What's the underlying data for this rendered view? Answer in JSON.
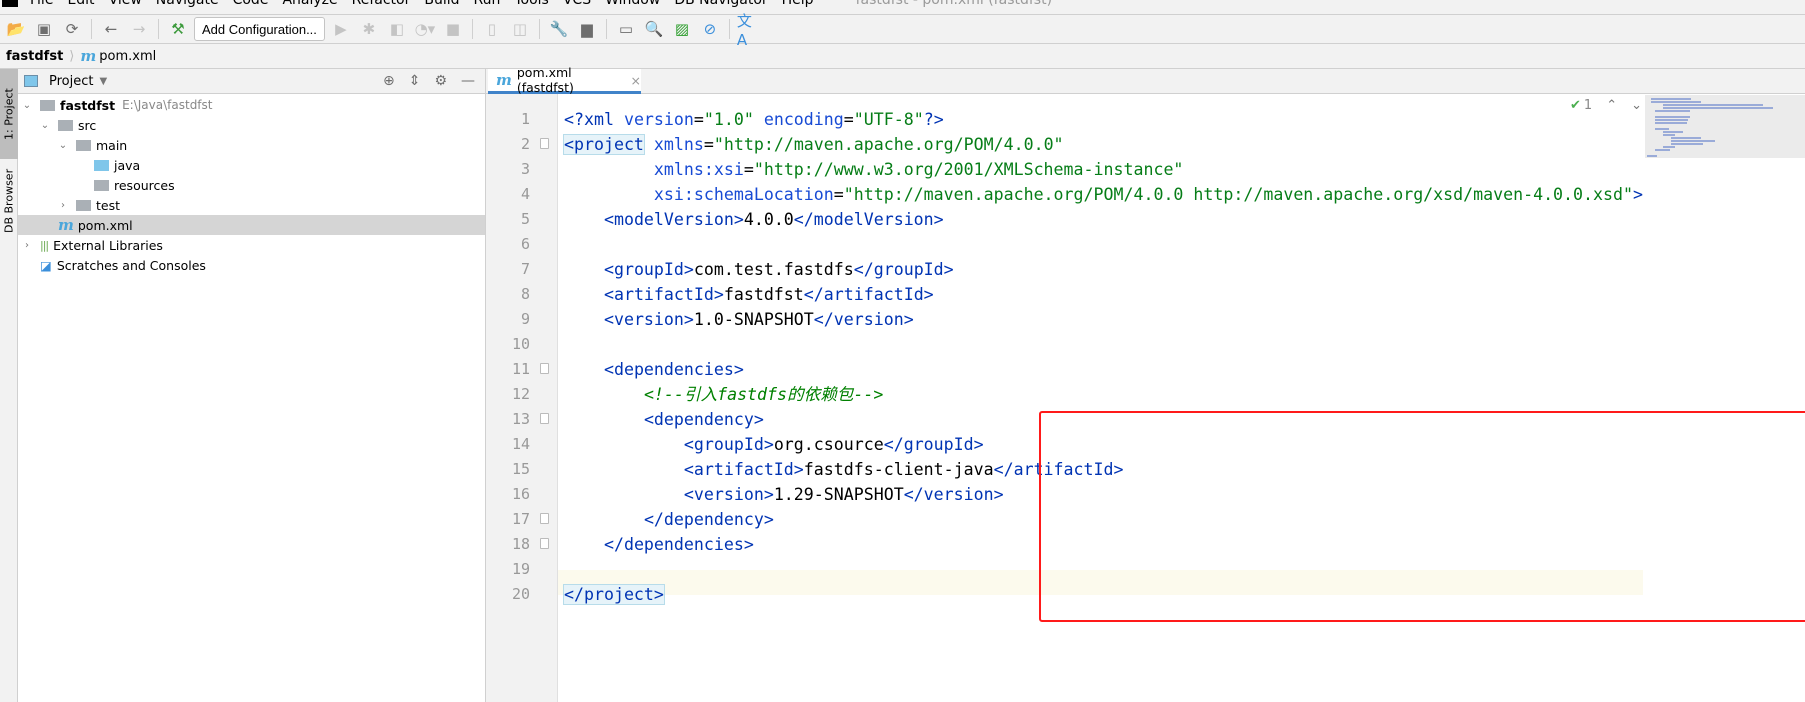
{
  "menu": {
    "items": [
      "File",
      "Edit",
      "View",
      "Navigate",
      "Code",
      "Analyze",
      "Refactor",
      "Build",
      "Run",
      "Tools",
      "VCS",
      "Window",
      "DB Navigator",
      "Help"
    ],
    "window_title": "fastdfst - pom.xml (fastdfst)"
  },
  "toolbar": {
    "add_configuration": "Add Configuration..."
  },
  "breadcrumb": {
    "project": "fastdfst",
    "file": "pom.xml",
    "file_icon": "m"
  },
  "side_tabs": {
    "project": "1: Project",
    "db_browser": "DB Browser"
  },
  "project_panel": {
    "title": "Project",
    "tree": [
      {
        "label": "fastdfst",
        "path": "E:\\Java\\fastdfst",
        "level": 0,
        "arrow": "v",
        "icon": "module-folder"
      },
      {
        "label": "src",
        "level": 1,
        "arrow": "v",
        "icon": "folder"
      },
      {
        "label": "main",
        "level": 2,
        "arrow": "v",
        "icon": "folder"
      },
      {
        "label": "java",
        "level": 3,
        "arrow": "",
        "icon": "source-folder"
      },
      {
        "label": "resources",
        "level": 3,
        "arrow": "",
        "icon": "resources-folder"
      },
      {
        "label": "test",
        "level": 2,
        "arrow": ">",
        "icon": "folder"
      },
      {
        "label": "pom.xml",
        "level": 1,
        "arrow": "",
        "icon": "maven-file",
        "selected": true
      },
      {
        "label": "External Libraries",
        "level": 0,
        "arrow": ">",
        "icon": "libraries"
      },
      {
        "label": "Scratches and Consoles",
        "level": 0,
        "arrow": "",
        "icon": "scratches"
      }
    ]
  },
  "editor": {
    "tab_label": "pom.xml (fastdfst)",
    "inspection_count": "1",
    "current_line": 20,
    "lines": [
      [
        [
          "t",
          "<?xml "
        ],
        [
          "a",
          "version"
        ],
        [
          "",
          "="
        ],
        [
          "v",
          "\"1.0\""
        ],
        [
          "a",
          " encoding"
        ],
        [
          "",
          "="
        ],
        [
          "v",
          "\"UTF-8\""
        ],
        [
          "t",
          "?>"
        ]
      ],
      [
        [
          "t",
          "<project"
        ],
        [
          "a",
          " xmlns"
        ],
        [
          "",
          "="
        ],
        [
          "v",
          "\"http://maven.apache.org/POM/4.0.0\""
        ]
      ],
      [
        [
          "",
          "         "
        ],
        [
          "a",
          "xmlns:xsi"
        ],
        [
          "",
          "="
        ],
        [
          "v",
          "\"http://www.w3.org/2001/XMLSchema-instance\""
        ]
      ],
      [
        [
          "",
          "         "
        ],
        [
          "a",
          "xsi:schemaLocation"
        ],
        [
          "",
          "="
        ],
        [
          "v",
          "\"http://maven.apache.org/POM/4.0.0 http://maven.apache.org/xsd/maven-4.0.0.xsd\""
        ],
        [
          "t",
          ">"
        ]
      ],
      [
        [
          "",
          "    "
        ],
        [
          "t",
          "<modelVersion>"
        ],
        [
          "",
          "4.0.0"
        ],
        [
          "t",
          "</modelVersion>"
        ]
      ],
      [],
      [
        [
          "",
          "    "
        ],
        [
          "t",
          "<groupId>"
        ],
        [
          "",
          "com.test.fastdfs"
        ],
        [
          "t",
          "</groupId>"
        ]
      ],
      [
        [
          "",
          "    "
        ],
        [
          "t",
          "<artifactId>"
        ],
        [
          "",
          "fastdfst"
        ],
        [
          "t",
          "</artifactId>"
        ]
      ],
      [
        [
          "",
          "    "
        ],
        [
          "t",
          "<version>"
        ],
        [
          "",
          "1.0-SNAPSHOT"
        ],
        [
          "t",
          "</version>"
        ]
      ],
      [],
      [
        [
          "",
          "    "
        ],
        [
          "t",
          "<dependencies>"
        ]
      ],
      [
        [
          "",
          "        "
        ],
        [
          "c",
          "<!--引入fastdfs的依赖包-->"
        ]
      ],
      [
        [
          "",
          "        "
        ],
        [
          "t",
          "<dependency>"
        ]
      ],
      [
        [
          "",
          "            "
        ],
        [
          "t",
          "<groupId>"
        ],
        [
          "",
          "org.csource"
        ],
        [
          "t",
          "</groupId>"
        ]
      ],
      [
        [
          "",
          "            "
        ],
        [
          "t",
          "<artifactId>"
        ],
        [
          "",
          "fastdfs-client-java"
        ],
        [
          "t",
          "</artifactId>"
        ]
      ],
      [
        [
          "",
          "            "
        ],
        [
          "t",
          "<version>"
        ],
        [
          "",
          "1.29-SNAPSHOT"
        ],
        [
          "t",
          "</version>"
        ]
      ],
      [
        [
          "",
          "        "
        ],
        [
          "t",
          "</dependency>"
        ]
      ],
      [
        [
          "",
          "    "
        ],
        [
          "t",
          "</dependencies>"
        ]
      ],
      [],
      [
        [
          "t",
          "</project>"
        ]
      ]
    ]
  },
  "colors": {
    "tag": "#0033b3",
    "attribute": "#174ad4",
    "value": "#067d17",
    "comment": "#008000",
    "highlight_box": "#ff1a1a",
    "current_line": "#fcfaed"
  }
}
